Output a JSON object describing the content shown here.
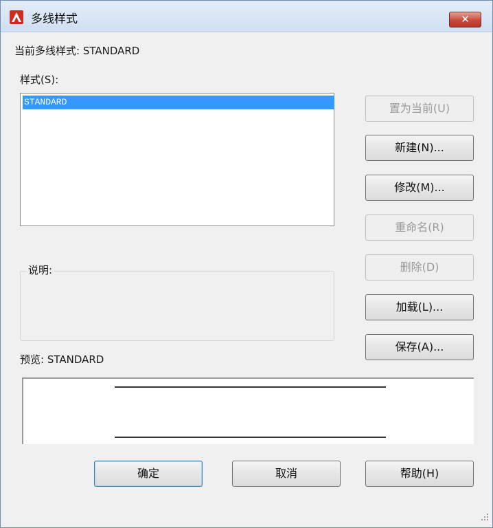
{
  "window": {
    "title": "多线样式",
    "close_label": "✕"
  },
  "current_style_label": "当前多线样式: STANDARD",
  "styles_label": "样式(S):",
  "styles": [
    {
      "name": "STANDARD",
      "selected": true
    }
  ],
  "description_label": "说明:",
  "description_text": "",
  "preview_label": "预览: STANDARD",
  "buttons": {
    "set_current": "置为当前(U)",
    "new": "新建(N)...",
    "modify": "修改(M)...",
    "rename": "重命名(R)",
    "delete": "删除(D)",
    "load": "加载(L)...",
    "save": "保存(A)...",
    "ok": "确定",
    "cancel": "取消",
    "help": "帮助(H)"
  },
  "disabled_buttons": [
    "set_current",
    "rename",
    "delete"
  ],
  "colors": {
    "selection": "#3399ff",
    "app_icon": "#d12a1e",
    "close_button": "#c9483a"
  }
}
